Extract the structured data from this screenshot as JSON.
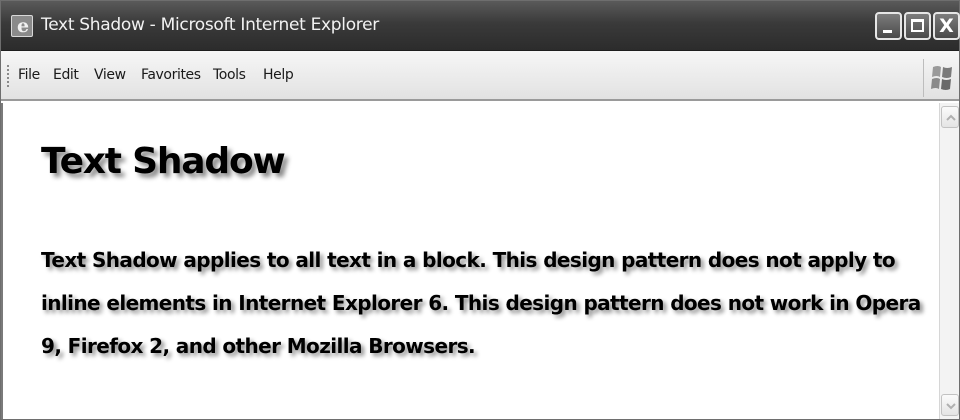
{
  "window": {
    "title": "Text Shadow - Microsoft Internet Explorer",
    "app_icon": "internet-explorer-icon",
    "app_icon_glyph": "e",
    "controls": {
      "minimize_icon": "minimize-icon",
      "maximize_icon": "maximize-icon",
      "close_icon": "close-icon",
      "close_glyph": "X"
    }
  },
  "menubar": {
    "items": [
      {
        "label": "File"
      },
      {
        "label": "Edit"
      },
      {
        "label": "View"
      },
      {
        "label": "Favorites"
      },
      {
        "label": "Tools"
      },
      {
        "label": "Help"
      }
    ],
    "brand_icon": "windows-flag-icon"
  },
  "page": {
    "heading": "Text Shadow",
    "paragraph": "Text Shadow applies to all text in a block. This design pattern does not apply to inline elements in Internet Explorer 6. This design pattern does not work in Opera 9, Firefox 2, and other Mozilla Browsers."
  },
  "scrollbar": {
    "up_icon": "scroll-up-arrow-icon",
    "down_icon": "scroll-down-arrow-icon"
  },
  "colors": {
    "titlebar": "#3a3a3a",
    "menubar": "#ececec",
    "text": "#000000",
    "shadow": "#8a8a8a"
  }
}
